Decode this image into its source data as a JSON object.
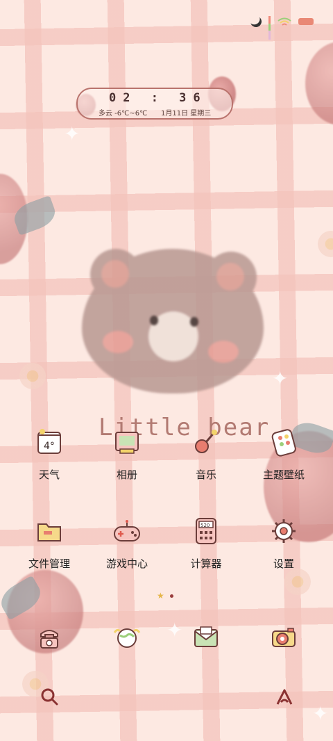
{
  "status_bar": {
    "icons": [
      "moon-icon",
      "signal-icon",
      "wifi-icon",
      "battery-icon"
    ]
  },
  "clock_widget": {
    "time": "02 : 36",
    "weather": "多云 -6℃~6℃",
    "date": "1月11日 星期三"
  },
  "wallpaper": {
    "text": "Little bear"
  },
  "apps": {
    "row1": [
      {
        "label": "天气",
        "icon": "weather-calendar-icon",
        "icon_text": "4°"
      },
      {
        "label": "相册",
        "icon": "album-icon"
      },
      {
        "label": "音乐",
        "icon": "music-icon"
      },
      {
        "label": "主题壁纸",
        "icon": "theme-palette-icon"
      }
    ],
    "row2": [
      {
        "label": "文件管理",
        "icon": "folder-icon"
      },
      {
        "label": "游戏中心",
        "icon": "gamepad-icon"
      },
      {
        "label": "计算器",
        "icon": "calculator-icon",
        "icon_text": "520"
      },
      {
        "label": "设置",
        "icon": "gear-icon"
      }
    ],
    "dock": [
      {
        "icon": "telephone-icon"
      },
      {
        "icon": "globe-icon"
      },
      {
        "icon": "envelope-icon"
      },
      {
        "icon": "camera-icon"
      }
    ]
  },
  "page_indicator": {
    "pages": 2,
    "current": 1
  },
  "bottom": {
    "icons": [
      "search-icon",
      "assistant-icon"
    ]
  },
  "colors": {
    "accent": "#9a3d3d",
    "text": "#222222",
    "widget_border": "#b9736d"
  }
}
